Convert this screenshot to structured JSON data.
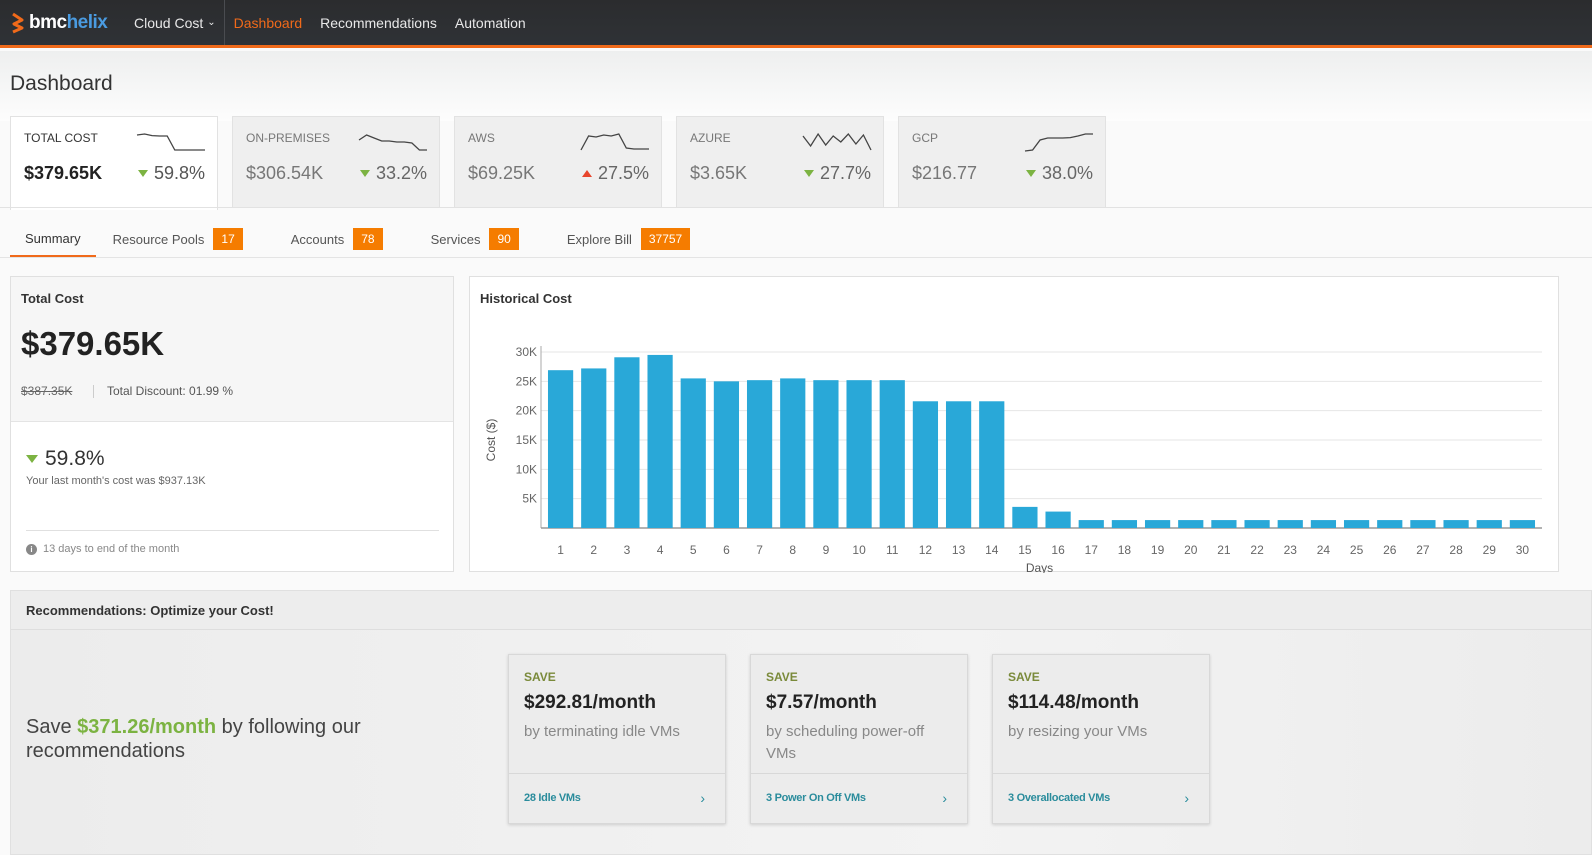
{
  "nav": {
    "logo_bmc": "bmc",
    "logo_helix": "helix",
    "product": "Cloud Cost",
    "items": [
      {
        "label": "Dashboard",
        "active": true
      },
      {
        "label": "Recommendations",
        "active": false
      },
      {
        "label": "Automation",
        "active": false
      }
    ]
  },
  "page": {
    "title": "Dashboard"
  },
  "kpis": [
    {
      "label": "TOTAL COST",
      "value": "$379.65K",
      "change": "59.8%",
      "direction": "down",
      "active": true,
      "trend": [
        0.85,
        0.9,
        0.82,
        0.8,
        0.8,
        0.1,
        0.1,
        0.1,
        0.1,
        0.1
      ]
    },
    {
      "label": "ON-PREMISES",
      "value": "$306.54K",
      "change": "33.2%",
      "direction": "down",
      "active": false,
      "trend": [
        0.6,
        0.85,
        0.7,
        0.55,
        0.55,
        0.5,
        0.5,
        0.45,
        0.1,
        0.1
      ]
    },
    {
      "label": "AWS",
      "value": "$69.25K",
      "change": "27.5%",
      "direction": "up",
      "active": false,
      "trend": [
        0.1,
        0.8,
        0.75,
        0.85,
        0.8,
        0.9,
        0.2,
        0.15,
        0.15,
        0.15
      ]
    },
    {
      "label": "AZURE",
      "value": "$3.65K",
      "change": "27.7%",
      "direction": "down",
      "active": false,
      "trend": [
        0.8,
        0.3,
        0.9,
        0.35,
        0.8,
        0.5,
        0.9,
        0.4,
        0.85,
        0.1
      ]
    },
    {
      "label": "GCP",
      "value": "$216.77",
      "change": "38.0%",
      "direction": "down",
      "active": false,
      "trend": [
        0.05,
        0.1,
        0.6,
        0.7,
        0.7,
        0.7,
        0.72,
        0.8,
        0.9,
        0.9
      ]
    }
  ],
  "tabs": [
    {
      "label": "Summary",
      "badge": null,
      "active": true
    },
    {
      "label": "Resource Pools",
      "badge": "17",
      "active": false
    },
    {
      "label": "Accounts",
      "badge": "78",
      "active": false
    },
    {
      "label": "Services",
      "badge": "90",
      "active": false
    },
    {
      "label": "Explore Bill",
      "badge": "37757",
      "active": false
    }
  ],
  "total_cost": {
    "title": "Total Cost",
    "value": "$379.65K",
    "original": "$387.35K",
    "discount": "Total Discount: 01.99 %",
    "change": "59.8%",
    "last_month": "Your last month's cost was $937.13K",
    "days_left": "13 days to end of the month"
  },
  "chart_data": {
    "type": "bar",
    "title": "Historical Cost",
    "xlabel": "Days",
    "ylabel": "Cost ($)",
    "categories": [
      "1",
      "2",
      "3",
      "4",
      "5",
      "6",
      "7",
      "8",
      "9",
      "10",
      "11",
      "12",
      "13",
      "14",
      "15",
      "16",
      "17",
      "18",
      "19",
      "20",
      "21",
      "22",
      "23",
      "24",
      "25",
      "26",
      "27",
      "28",
      "29",
      "30"
    ],
    "values": [
      26900,
      27200,
      29100,
      29500,
      25500,
      25000,
      25200,
      25500,
      25200,
      25200,
      25200,
      21600,
      21600,
      21600,
      3600,
      2800,
      1350,
      1350,
      1350,
      1350,
      1350,
      1350,
      1350,
      1350,
      1350,
      1350,
      1350,
      1350,
      1350,
      1350
    ],
    "yticks": [
      5000,
      10000,
      15000,
      20000,
      25000,
      30000
    ],
    "ytick_labels": [
      "5K",
      "10K",
      "15K",
      "20K",
      "25K",
      "30K"
    ],
    "ylim": [
      0,
      30000
    ],
    "grid": true,
    "bar_color": "#29a8d8"
  },
  "recommendations": {
    "header": "Recommendations: Optimize your Cost!",
    "save_prefix": "Save ",
    "save_amount": "$371.26/month",
    "save_suffix": " by following our recommendations",
    "cards": [
      {
        "save_label": "SAVE",
        "amount": "$292.81/month",
        "description": "by terminating idle VMs",
        "link": "28 Idle VMs"
      },
      {
        "save_label": "SAVE",
        "amount": "$7.57/month",
        "description": "by scheduling power-off VMs",
        "link": "3 Power On Off VMs"
      },
      {
        "save_label": "SAVE",
        "amount": "$114.48/month",
        "description": "by resizing your VMs",
        "link": "3 Overallocated VMs"
      }
    ]
  },
  "colors": {
    "accent": "#f06a1a",
    "badge": "#f57c00",
    "positive": "#7cb342",
    "negative": "#e8452c",
    "link": "#2a8c9c"
  }
}
